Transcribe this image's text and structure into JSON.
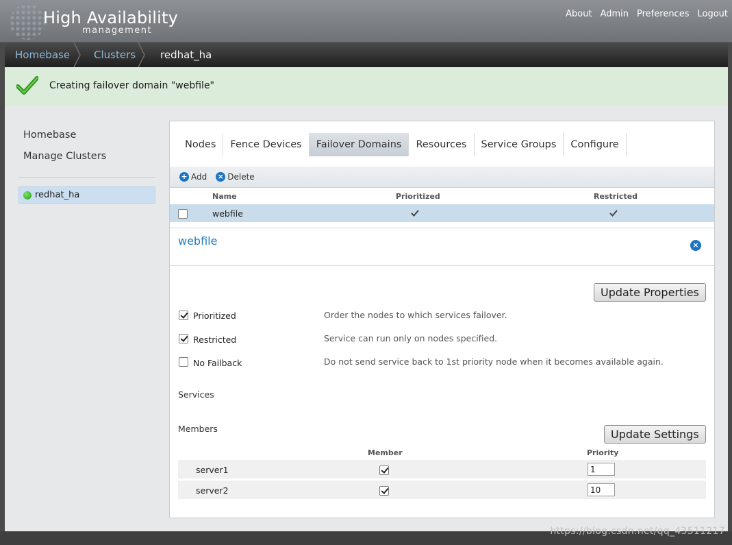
{
  "header": {
    "title": "High Availability",
    "subtitle": "management",
    "links": [
      "About",
      "Admin",
      "Preferences",
      "Logout"
    ]
  },
  "breadcrumb": [
    "Homebase",
    "Clusters",
    "redhat_ha"
  ],
  "notice": {
    "icon": "checkmark-icon",
    "message": "Creating failover domain \"webfile\""
  },
  "sidebar": {
    "links": [
      "Homebase",
      "Manage Clusters"
    ],
    "cluster": {
      "name": "redhat_ha",
      "status_color": "#21a010"
    }
  },
  "tabs": [
    "Nodes",
    "Fence Devices",
    "Failover Domains",
    "Resources",
    "Service Groups",
    "Configure"
  ],
  "active_tab": "Failover Domains",
  "toolbar": {
    "add_label": "Add",
    "delete_label": "Delete"
  },
  "domain_table": {
    "columns": [
      "Name",
      "Prioritized",
      "Restricted"
    ],
    "rows": [
      {
        "name": "webfile",
        "prioritized": true,
        "restricted": true,
        "selected": false
      }
    ]
  },
  "detail": {
    "title": "webfile",
    "update_properties_label": "Update Properties",
    "options": [
      {
        "label": "Prioritized",
        "checked": true,
        "description": "Order the nodes to which services failover."
      },
      {
        "label": "Restricted",
        "checked": true,
        "description": "Service can run only on nodes specified."
      },
      {
        "label": "No Failback",
        "checked": false,
        "description": "Do not send service back to 1st priority node when it becomes available again."
      }
    ],
    "services_label": "Services",
    "members_label": "Members",
    "update_settings_label": "Update Settings",
    "member_columns": [
      "Member",
      "Priority"
    ],
    "members": [
      {
        "name": "server1",
        "member": true,
        "priority": "1"
      },
      {
        "name": "server2",
        "member": true,
        "priority": "10"
      }
    ]
  },
  "watermark": "https://blog.csdn.net/qq_43511217",
  "colors": {
    "accent": "#1e7bbf",
    "selection": "#c8dceb",
    "notice_bg": "#dcecdb"
  }
}
